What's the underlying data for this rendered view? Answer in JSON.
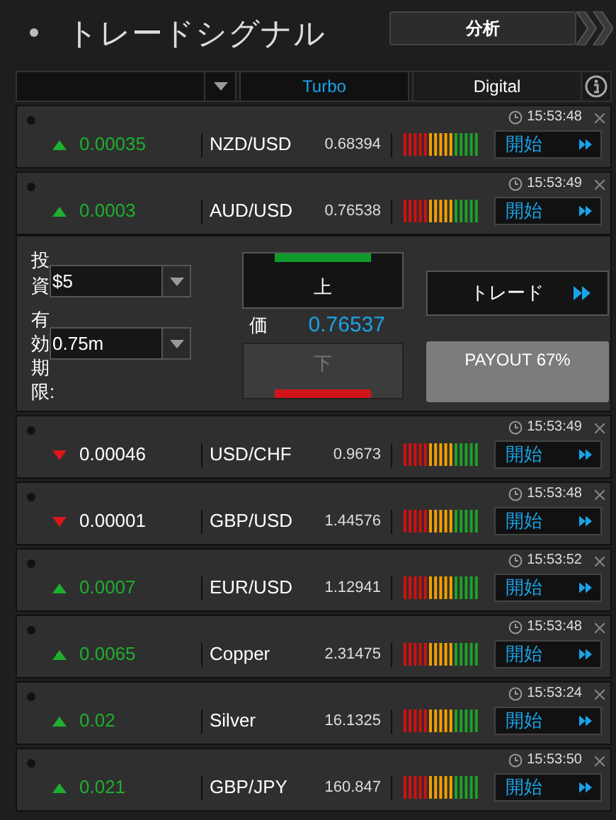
{
  "header": {
    "title": "トレードシグナル",
    "analysis_button": "分析"
  },
  "tabs": [
    {
      "label": "Turbo",
      "selected": true
    },
    {
      "label": "Digital",
      "selected": false
    }
  ],
  "signals": [
    {
      "time": "15:53:48",
      "kind": "up",
      "change": "0.00035",
      "symbol": "NZD/USD",
      "price": "0.68394",
      "button": "開始"
    },
    {
      "time": "15:53:49",
      "kind": "up",
      "change": "0.0003",
      "symbol": "AUD/USD",
      "price": "0.76538",
      "button": "開始",
      "trade_panel": {
        "investment_label": "投資",
        "investment_value": "$5",
        "expiry_label": "有効期限:",
        "expiry_value": "0.75m",
        "up_button": {
          "label": "上",
          "disabled": false
        },
        "price_label": "価",
        "price": "0.76537",
        "down_button": {
          "label": "下",
          "disabled": true
        },
        "trade_button": "トレード",
        "payout": "PAYOUT 67%"
      }
    },
    {
      "time": "15:53:49",
      "kind": "down",
      "change": "0.00046",
      "symbol": "USD/CHF",
      "price": "0.9673",
      "button": "開始"
    },
    {
      "time": "15:53:48",
      "kind": "down",
      "change": "0.00001",
      "symbol": "GBP/USD",
      "price": "1.44576",
      "button": "開始"
    },
    {
      "time": "15:53:52",
      "kind": "up",
      "change": "0.0007",
      "symbol": "EUR/USD",
      "price": "1.12941",
      "button": "開始"
    },
    {
      "time": "15:53:48",
      "kind": "up",
      "change": "0.0065",
      "symbol": "Copper",
      "price": "2.31475",
      "button": "開始"
    },
    {
      "time": "15:53:24",
      "kind": "up",
      "change": "0.02",
      "symbol": "Silver",
      "price": "16.1325",
      "button": "開始"
    },
    {
      "time": "15:53:50",
      "kind": "up",
      "change": "0.021",
      "symbol": "GBP/JPY",
      "price": "160.847",
      "button": "開始"
    }
  ]
}
